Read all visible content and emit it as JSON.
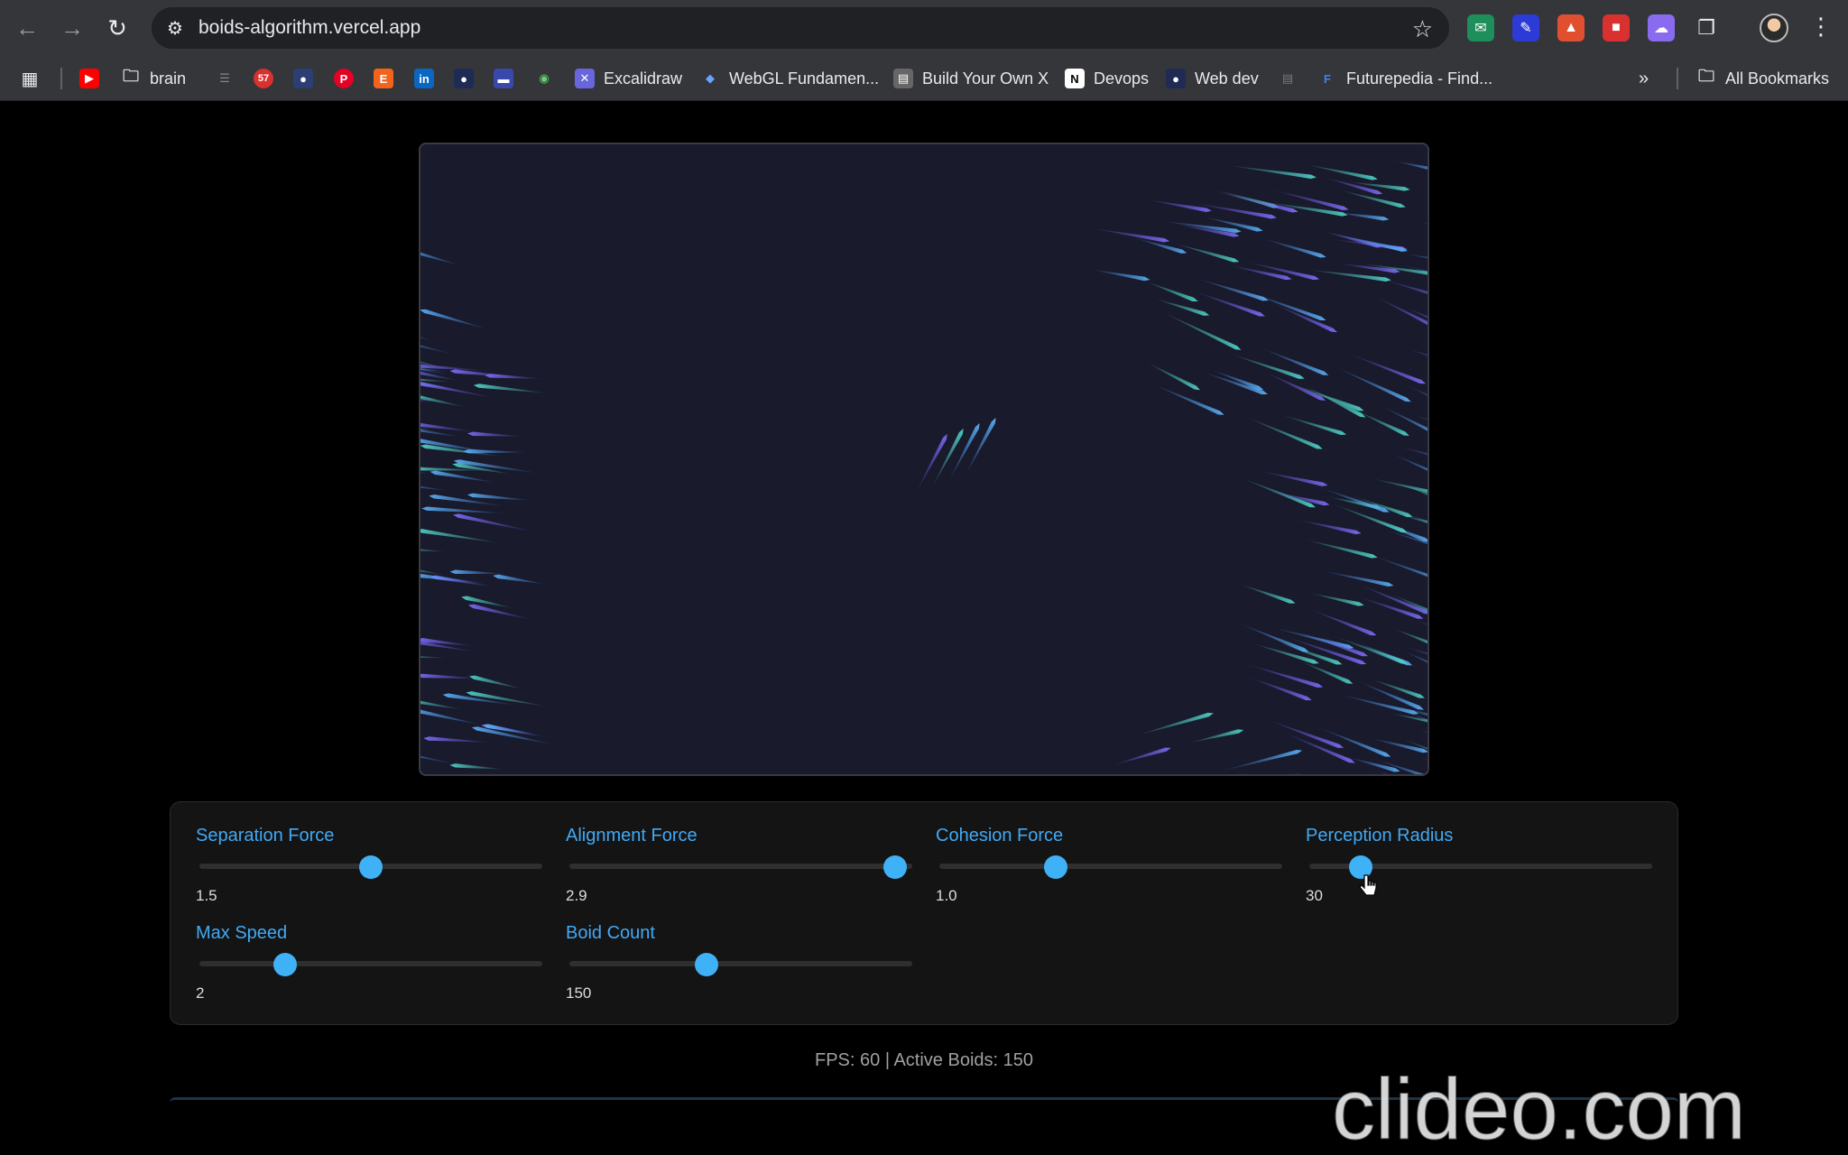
{
  "browser": {
    "url": "boids-algorithm.vercel.app",
    "bookmarks": {
      "brain": "brain",
      "excalidraw": "Excalidraw",
      "webgl": "WebGL Fundamen...",
      "build_own_x": "Build Your Own X",
      "devops": "Devops",
      "webdev": "Web dev",
      "futurepedia": "Futurepedia - Find...",
      "all_bookmarks": "All Bookmarks",
      "badge_count": "57"
    }
  },
  "controls": {
    "separation": {
      "label": "Separation Force",
      "value": "1.5",
      "fraction": 0.5
    },
    "alignment": {
      "label": "Alignment Force",
      "value": "2.9",
      "fraction": 0.95
    },
    "cohesion": {
      "label": "Cohesion Force",
      "value": "1.0",
      "fraction": 0.34
    },
    "perception": {
      "label": "Perception Radius",
      "value": "30",
      "fraction": 0.15
    },
    "max_speed": {
      "label": "Max Speed",
      "value": "2",
      "fraction": 0.25
    },
    "boid_count": {
      "label": "Boid Count",
      "value": "150",
      "fraction": 0.4
    }
  },
  "stats": "FPS: 60 | Active Boids: 150",
  "watermark": "clideo.com",
  "colors": {
    "accent": "#41a9f5",
    "thumb": "#3fb1f6",
    "canvas_bg": "#191a2c",
    "boid_teal": "#4fd1c5",
    "boid_violet": "#6b5cf0"
  }
}
